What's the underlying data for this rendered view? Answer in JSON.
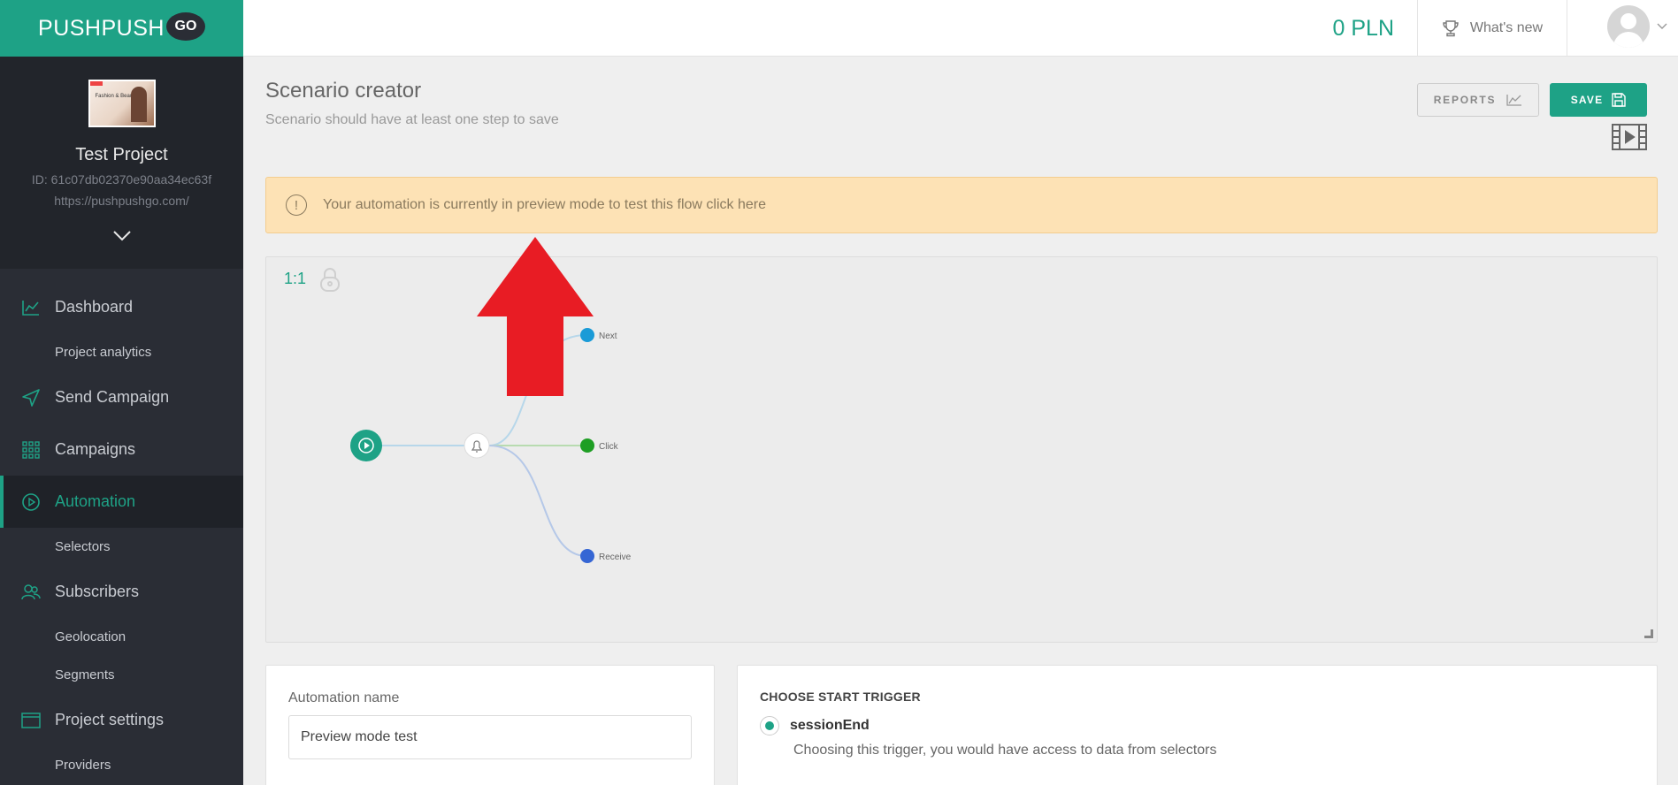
{
  "brand": {
    "name": "PUSHPUSH",
    "badge": "GO",
    "accent": "#1ea286"
  },
  "project": {
    "name": "Test Project",
    "id": "ID: 61c07db02370e90aa34ec63f",
    "url": "https://pushpushgo.com/",
    "thumb_text": "Fashion & Beauty"
  },
  "nav": {
    "items": [
      {
        "label": "Dashboard",
        "icon": "chart-line-icon"
      },
      {
        "label": "Project analytics",
        "sub": true
      },
      {
        "label": "Send Campaign",
        "icon": "paper-plane-icon"
      },
      {
        "label": "Campaigns",
        "icon": "grid-icon"
      },
      {
        "label": "Automation",
        "icon": "play-circle-icon",
        "active": true
      },
      {
        "label": "Selectors",
        "sub": true
      },
      {
        "label": "Subscribers",
        "icon": "users-icon"
      },
      {
        "label": "Geolocation",
        "sub": true
      },
      {
        "label": "Segments",
        "sub": true
      },
      {
        "label": "Project settings",
        "icon": "window-icon"
      },
      {
        "label": "Providers",
        "sub": true
      }
    ]
  },
  "topbar": {
    "balance": "0 PLN",
    "whats_new": "What's new"
  },
  "header": {
    "title": "Scenario creator",
    "subtitle": "Scenario should have at least one step to save",
    "reports_label": "REPORTS",
    "save_label": "SAVE"
  },
  "alert": {
    "text": "Your automation is currently in preview mode to test this flow click here",
    "color": "#fde2b5"
  },
  "canvas": {
    "zoom": "1:1",
    "nodes": {
      "start": "play-circle-icon",
      "notification": "bell-icon"
    },
    "outputs": [
      {
        "label": "Next",
        "color": "#1a9bd7"
      },
      {
        "label": "Click",
        "color": "#1e9e24"
      },
      {
        "label": "Receive",
        "color": "#3566d4"
      }
    ]
  },
  "form": {
    "name_label": "Automation name",
    "name_value": "Preview mode test"
  },
  "trigger": {
    "heading": "CHOOSE START TRIGGER",
    "options": [
      {
        "name": "sessionEnd",
        "selected": true,
        "description": "Choosing this trigger, you would have access to data from selectors"
      }
    ]
  }
}
